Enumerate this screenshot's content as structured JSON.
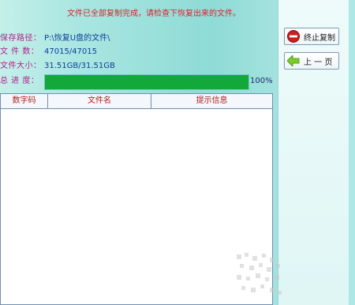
{
  "status": {
    "message": "文件已全部复制完成，请检查下恢复出来的文件。"
  },
  "info": {
    "save_path_label": "保存路径：",
    "save_path_value": "P:\\恢复U盘的文件\\",
    "file_count_label": "文 件 数：",
    "file_count_value": "47015/47015",
    "file_size_label": "文件大小：",
    "file_size_value": "31.51GB/31.51GB",
    "progress_label": "总 进 度：",
    "progress_text": "100%",
    "progress_fraction": 1.0
  },
  "table": {
    "columns": [
      "数字码",
      "文件名",
      "提示信息"
    ],
    "rows": []
  },
  "buttons": {
    "stop_copy_label": "终止复制",
    "prev_page_label": "上 一 页"
  },
  "icons": {
    "stop_icon": "stop-icon",
    "back_arrow_icon": "back-arrow-icon"
  },
  "colors": {
    "progress_fill": "#12a83a",
    "label_color": "#b21f8a",
    "value_color": "#0d3f9a",
    "status_color": "#d8242a"
  }
}
